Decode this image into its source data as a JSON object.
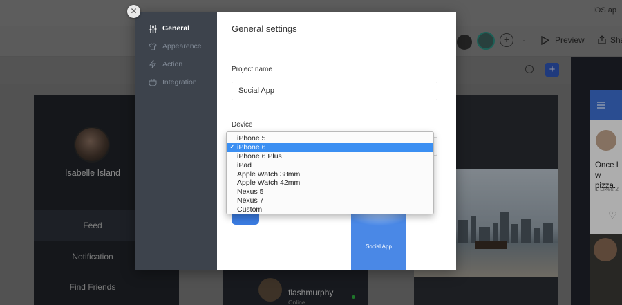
{
  "background": {
    "top_right_label": "iOS ap",
    "toolbar": {
      "preview_label": "Preview",
      "share_label": "Sha"
    },
    "left_card": {
      "user_name": "Isabelle Island",
      "nav": [
        "Feed",
        "Notification",
        "Find Friends"
      ]
    },
    "middle_card": {
      "username": "flashmurphy",
      "status": "Online"
    },
    "side_card": {
      "post_text_line1": "Once I w",
      "post_text_line2": "pizza.",
      "likes": "1 Likes  2"
    }
  },
  "modal": {
    "sidebar": {
      "items": [
        {
          "label": "General",
          "icon": "sliders-icon",
          "active": true
        },
        {
          "label": "Appearence",
          "icon": "shirt-icon",
          "active": false
        },
        {
          "label": "Action",
          "icon": "lightning-icon",
          "active": false
        },
        {
          "label": "Integration",
          "icon": "plug-icon",
          "active": false
        }
      ]
    },
    "title": "General settings",
    "project_name": {
      "label": "Project name",
      "value": "Social App"
    },
    "device": {
      "label": "Device",
      "selected": "iPhone 6",
      "options": [
        "iPhone 5",
        "iPhone 6",
        "iPhone 6 Plus",
        "iPad",
        "Apple Watch 38mm",
        "Apple Watch 42mm",
        "Nexus 5",
        "Nexus 7",
        "Custom"
      ]
    },
    "preview_app_name": "Social App",
    "close_symbol": "✕"
  },
  "colors": {
    "accent_blue": "#3b8ff2",
    "sidebar_bg": "#3d434c",
    "preview_blue": "#4a88e6"
  }
}
